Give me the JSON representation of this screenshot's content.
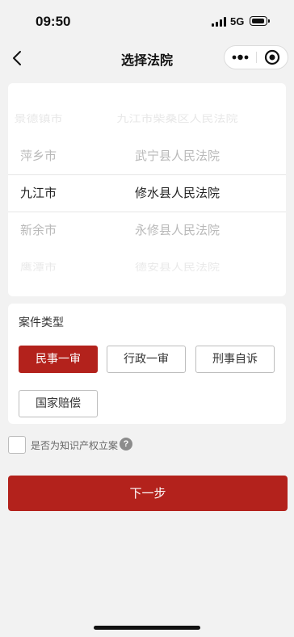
{
  "status_bar": {
    "time": "09:50",
    "network": "5G"
  },
  "nav": {
    "title": "选择法院",
    "icons": [
      "chevron-left-icon",
      "more-dots-icon",
      "target-circle-icon"
    ]
  },
  "picker": {
    "cities": [
      "景德镇市",
      "萍乡市",
      "九江市",
      "新余市",
      "鹰潭市"
    ],
    "courts": [
      "九江市柴桑区人民法院",
      "武宁县人民法院",
      "修水县人民法院",
      "永修县人民法院",
      "德安县人民法院"
    ],
    "selected_city": "九江市",
    "selected_court": "修水县人民法院"
  },
  "case_type": {
    "title": "案件类型",
    "options": [
      "民事一审",
      "行政一审",
      "刑事自诉",
      "国家赔偿"
    ],
    "selected": "民事一审"
  },
  "ip_case": {
    "label": "是否为知识产权立案",
    "help_icon": "question-circle-icon",
    "help_text": "?",
    "checked": false
  },
  "next_button": {
    "label": "下一步"
  },
  "colors": {
    "accent": "#b3221c",
    "background": "#f2f2f2",
    "card": "#ffffff"
  }
}
